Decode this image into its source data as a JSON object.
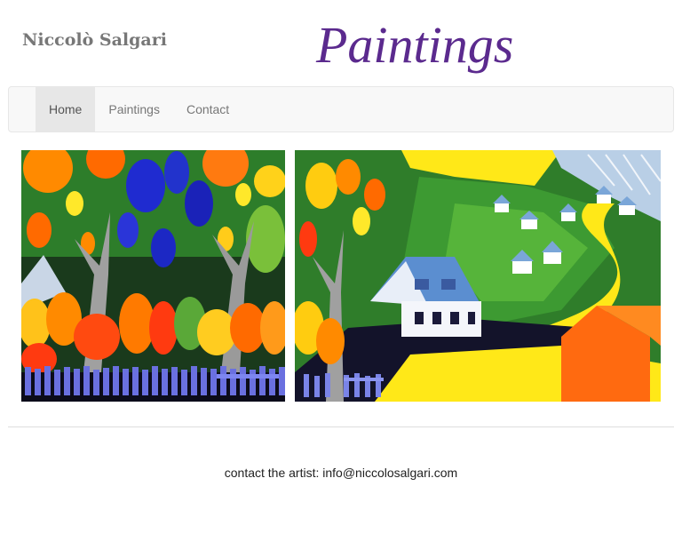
{
  "header": {
    "artist_name": "Niccolò Salgari",
    "site_title": "Paintings"
  },
  "nav": {
    "items": [
      {
        "label": "Home",
        "active": true
      },
      {
        "label": "Paintings",
        "active": false
      },
      {
        "label": "Contact",
        "active": false
      }
    ]
  },
  "gallery": {
    "paintings": [
      {
        "subject": "colorful trees behind a blue picket fence"
      },
      {
        "subject": "village with white houses and a yellow road on green hills"
      }
    ]
  },
  "footer": {
    "contact_text": "contact the artist: info@niccolosalgari.com"
  },
  "colors": {
    "title": "#5b2a8e",
    "artist_name": "#777777",
    "navbar_bg": "#f8f8f8",
    "nav_active_bg": "#e7e7e7"
  }
}
